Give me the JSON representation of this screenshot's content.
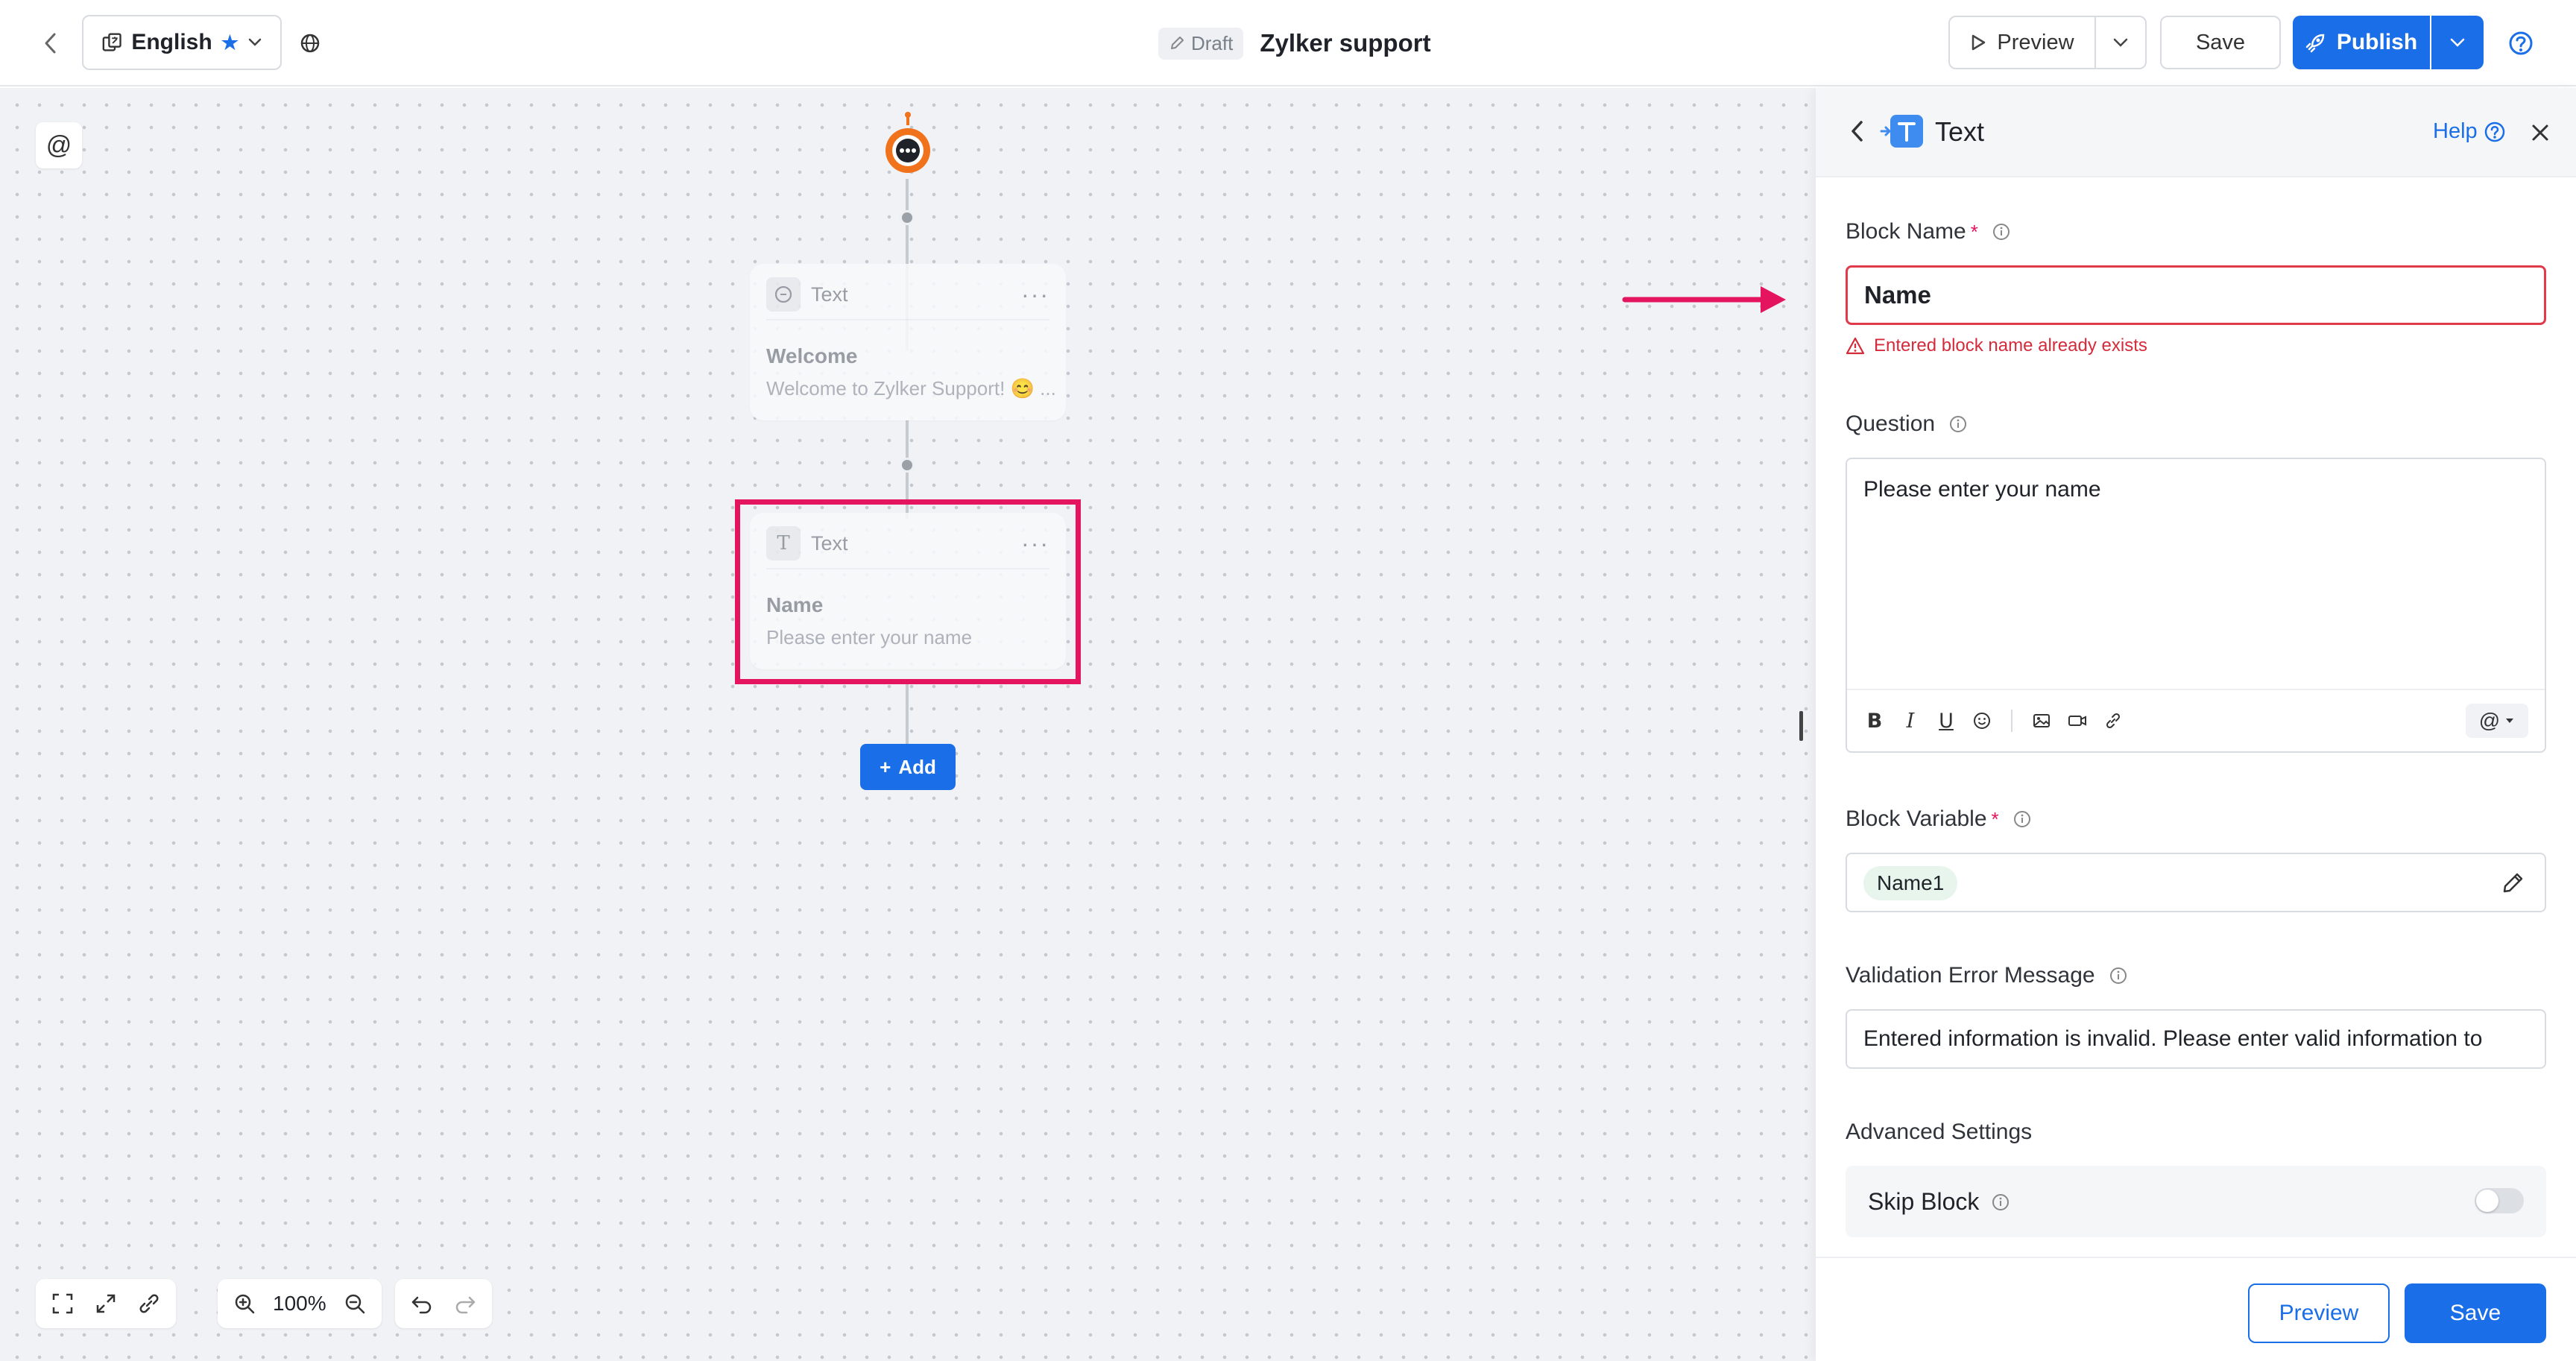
{
  "header": {
    "language": "English",
    "status_badge": "Draft",
    "title": "Zylker support",
    "preview_label": "Preview",
    "save_label": "Save",
    "publish_label": "Publish"
  },
  "canvas": {
    "nodes": [
      {
        "type": "Text",
        "title": "Welcome",
        "subtitle": "Welcome to Zylker Support! 😊 ..."
      },
      {
        "type": "Text",
        "title": "Name",
        "subtitle": "Please enter your name"
      }
    ],
    "add_label": "Add",
    "zoom_level": "100%"
  },
  "panel": {
    "title": "Text",
    "help_label": "Help",
    "block_name": {
      "label": "Block Name",
      "required_mark": "*",
      "value": "Name",
      "error": "Entered block name already exists"
    },
    "question": {
      "label": "Question",
      "value": "Please enter your name"
    },
    "block_variable": {
      "label": "Block Variable",
      "required_mark": "*",
      "value": "Name1"
    },
    "validation": {
      "label": "Validation Error Message",
      "value": "Entered information is invalid. Please enter valid information to"
    },
    "advanced_settings": "Advanced Settings",
    "skip_block": {
      "label": "Skip Block",
      "enabled": false
    },
    "footer": {
      "preview_label": "Preview",
      "save_label": "Save"
    }
  },
  "colors": {
    "accent": "#1a6ee8",
    "error": "#e03a4b",
    "highlight": "#e4145e",
    "bot": "#f0721b"
  }
}
